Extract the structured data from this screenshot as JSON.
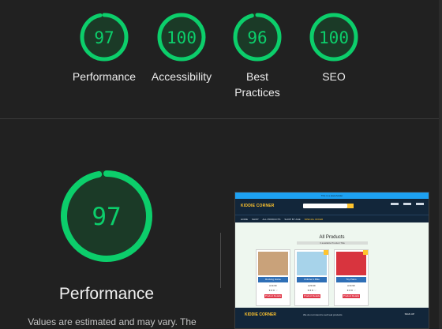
{
  "colors": {
    "background": "#212121",
    "pass_green": "#0cce6b",
    "gauge_fill": "#1b3a27"
  },
  "gauges": [
    {
      "score": "97",
      "value": 97,
      "label": "Performance"
    },
    {
      "score": "100",
      "value": 100,
      "label": "Accessibility"
    },
    {
      "score": "96",
      "value": 96,
      "label": "Best\nPractices"
    },
    {
      "score": "100",
      "value": 100,
      "label": "SEO"
    }
  ],
  "performance": {
    "score": "97",
    "value": 97,
    "title": "Performance",
    "note": "Values are estimated and may vary. The"
  },
  "thumbnail": {
    "banner": "This is a placeholder",
    "logo": "KIDDIE CORNER",
    "nav": [
      "HOME",
      "SHOP",
      "ALL PRODUCTS",
      "SHOP BY AGE",
      "SPECIAL OFFER"
    ],
    "heading": "All Products",
    "subheading": "3 available Product Title",
    "cards": [
      {
        "name": "Rocking Horse",
        "price": "£19.99",
        "button": "Product Details",
        "img_color": "#c9a27a"
      },
      {
        "name": "Children's Bike",
        "price": "£29.99",
        "button": "Product Details",
        "img_color": "#a7d3ea"
      },
      {
        "name": "Toy Piano",
        "price": "£19.99",
        "button": "Product Details",
        "img_color": "#d8343e"
      }
    ],
    "footer_logo": "KIDDIE CORNER",
    "footer_text": "We do not intend to sell real products",
    "footer_right": "SIGN UP"
  }
}
